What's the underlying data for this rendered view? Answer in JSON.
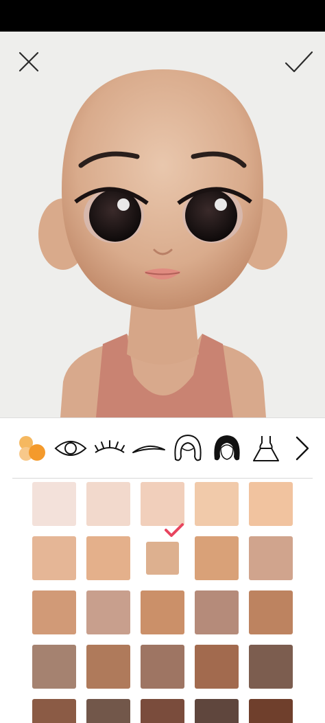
{
  "screen": {
    "close_icon": "close-icon",
    "confirm_icon": "checkmark-icon"
  },
  "toolbar": {
    "items": [
      {
        "name": "skin-tone",
        "icon": "skin-color-circles-icon",
        "active": true
      },
      {
        "name": "eyes",
        "icon": "eye-icon"
      },
      {
        "name": "eyelashes",
        "icon": "eyelash-icon"
      },
      {
        "name": "eyebrows",
        "icon": "eyebrow-icon"
      },
      {
        "name": "hair-light",
        "icon": "hair-outline-icon"
      },
      {
        "name": "hair-dark",
        "icon": "hair-filled-icon"
      },
      {
        "name": "outfit",
        "icon": "dress-icon"
      }
    ],
    "next_icon": "chevron-right-icon"
  },
  "colors": {
    "accent_orange": "#f5a640",
    "check_pink": "#e8455f",
    "canvas_bg": "#eeeeec"
  },
  "skin_swatches": {
    "selected_index": 7,
    "rows": [
      [
        "#f3e1da",
        "#f2d9cc",
        "#f1cfbb",
        "#f1caaa",
        "#f1c39f"
      ],
      [
        "#e5b696",
        "#e4b08b",
        "#ddb08f",
        "#d9a178",
        "#d0a48d"
      ],
      [
        "#d19a77",
        "#c89f8d",
        "#cb9069",
        "#b58b7a",
        "#bd8360"
      ],
      [
        "#a58270",
        "#af7a5b",
        "#9e7563",
        "#a26a4e",
        "#7c5d4f"
      ],
      [
        "#8b5b45",
        "#72574a",
        "#7a4c3c",
        "#5f463d",
        "#6f3f2c"
      ]
    ]
  }
}
